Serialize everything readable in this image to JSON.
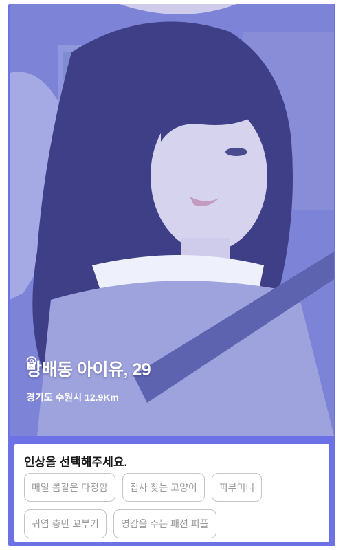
{
  "profile": {
    "name_age": "방배동 아이유, 29",
    "location": "경기도 수원시 12.9Km"
  },
  "impression": {
    "prompt": "인상을 선택해주세요.",
    "options": [
      "매일 봄같은 다정함",
      "집사 찾는 고양이",
      "피부미녀",
      "귀염 충만 꼬부기",
      "영감을 주는 패션 피플"
    ]
  },
  "colors": {
    "accent": "#6c72e6",
    "chip_border": "#c4c4c4",
    "chip_text": "#9a9a9a"
  },
  "icons": {
    "location": "location-pin-icon"
  }
}
